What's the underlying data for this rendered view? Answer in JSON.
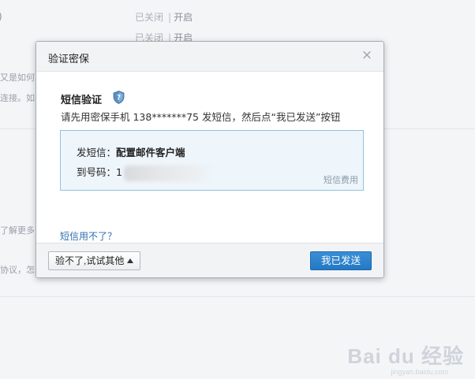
{
  "background": {
    "toggles": [
      {
        "closed": "已关闭",
        "sep": "|",
        "open": "开启"
      },
      {
        "closed": "已关闭",
        "sep": "|",
        "open": "开启"
      }
    ],
    "fragments": {
      "paren": ")",
      "f1": "又是如何",
      "f2": "连接。如",
      "f3": "了解更多",
      "f4": "协议，怎么"
    },
    "watermark": {
      "text": "Bai du 经验",
      "sub": "jingyan.baidu.com"
    }
  },
  "dialog": {
    "title": "验证密保",
    "close_label": "×",
    "sms_title": "短信验证",
    "description": "请先用密保手机 138*******75 发短信，然后点“我已发送”按钮",
    "send_label": "发短信：",
    "send_value": "配置邮件客户端",
    "to_label": "到号码：",
    "to_value_prefix": "1",
    "fee_label": "短信费用",
    "cant_use_link": "短信用不了？",
    "try_other_label": "验不了,试试其他",
    "sent_label": "我已发送"
  },
  "colors": {
    "accent": "#2478c4",
    "link": "#2f6fb0",
    "box_border": "#8fc3e2",
    "box_bg": "#eef5fb"
  }
}
